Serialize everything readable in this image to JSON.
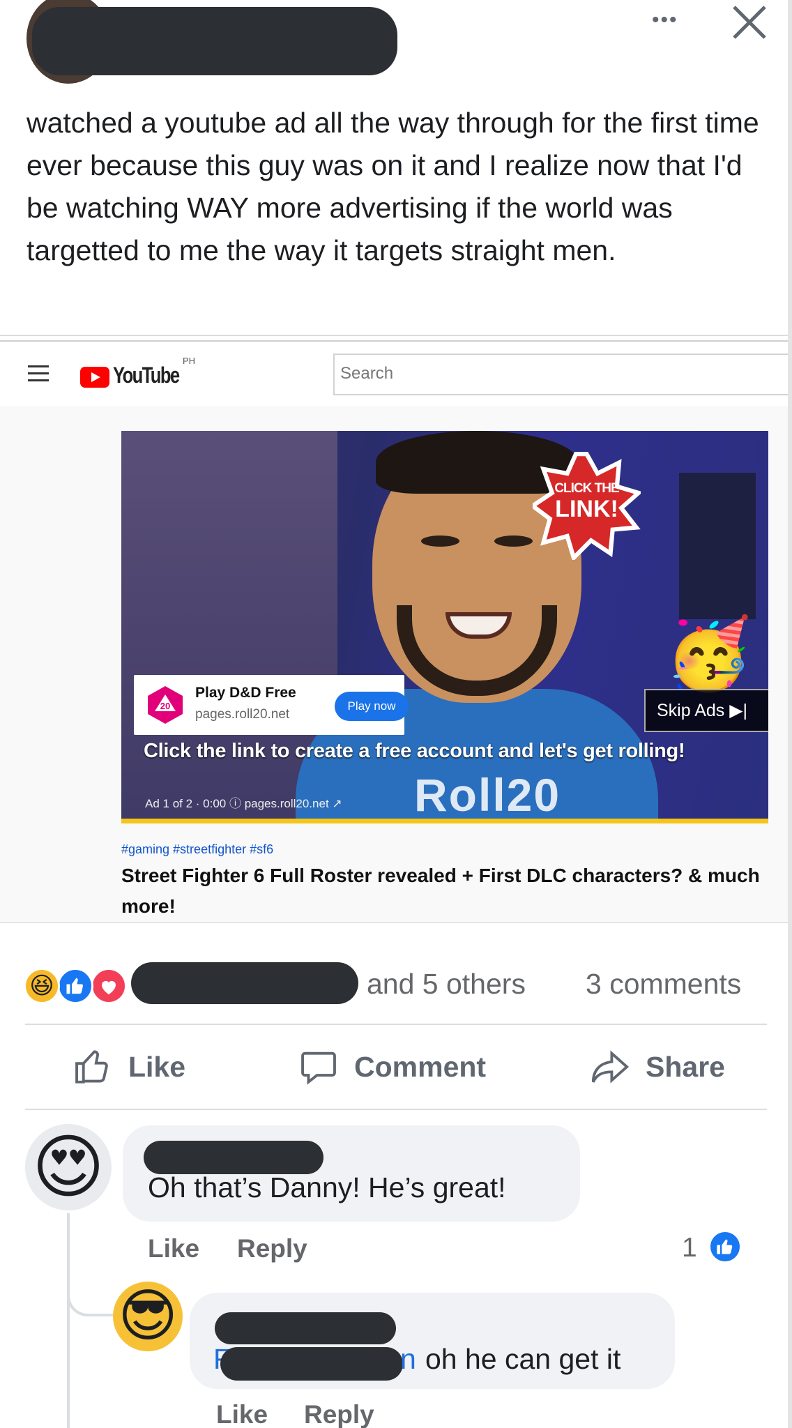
{
  "post": {
    "author_redacted": true,
    "body": "watched a youtube ad all the way through for the first time ever because this guy was on it and I realize now that I'd be watching WAY more advertising if the world was targetted to me the way it targets straight men."
  },
  "header": {
    "more_icon": "ellipsis-icon",
    "close_icon": "close-icon"
  },
  "embedded_screenshot": {
    "youtube": {
      "logo_text": "YouTube",
      "region": "PH",
      "search_placeholder": "Search"
    },
    "video": {
      "badge_line1": "CLICK THE",
      "badge_line2": "LINK!",
      "ad_card": {
        "title": "Play D&D Free",
        "domain": "pages.roll20.net",
        "button": "Play now",
        "icon_number": "20"
      },
      "skip_label": "Skip Ads ▶|",
      "caption": "Click the link to create a free account and let's get rolling!",
      "ad_meta": "Ad 1 of 2 · 0:00 ⓘ  pages.roll20.net ↗",
      "watermark": "Roll20"
    },
    "hashtags": "#gaming #streetfighter #sf6",
    "title": "Street Fighter 6 Full Roster revealed + First DLC characters? & much more!"
  },
  "reactions": {
    "icons": [
      "haha-icon",
      "like-icon",
      "love-icon"
    ],
    "others_text": "and 5 others",
    "comments_text": "3 comments"
  },
  "actions": [
    {
      "label": "Like",
      "icon": "thumbs-up-icon"
    },
    {
      "label": "Comment",
      "icon": "comment-icon"
    },
    {
      "label": "Share",
      "icon": "share-icon"
    }
  ],
  "comments": [
    {
      "avatar_emoji": "😍",
      "text": "Oh that’s Danny! He’s great!",
      "like": "Like",
      "reply": "Reply",
      "reaction_count": "1"
    },
    {
      "avatar_emoji": "😎",
      "mention_start": "F",
      "mention_end": "n",
      "text": "oh he can get it",
      "like": "Like",
      "reply": "Reply"
    }
  ],
  "colors": {
    "facebook_blue": "#1877f2",
    "redaction": "#2c2f33",
    "secondary_text": "#65676b",
    "comment_bubble": "#f0f2f5"
  }
}
